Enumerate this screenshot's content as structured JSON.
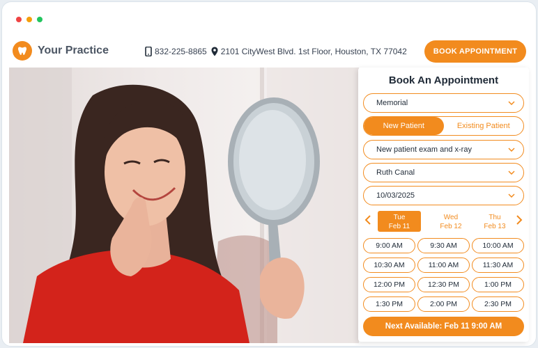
{
  "colors": {
    "accent": "#f28b1e",
    "dot_red": "#ef4444",
    "dot_yellow": "#f59e0b",
    "dot_green": "#22c55e"
  },
  "header": {
    "practice_name": "Your Practice",
    "phone": "832-225-8865",
    "address": "2101 CityWest Blvd. 1st Floor, Houston, TX 77042",
    "book_button": "BOOK APPOINTMENT"
  },
  "booking": {
    "title": "Book An Appointment",
    "location": "Memorial",
    "patient_tabs": [
      "New Patient",
      "Existing Patient"
    ],
    "selected_patient_tab": "New Patient",
    "reason": "New patient exam and x-ray",
    "provider": "Ruth Canal",
    "date": "10/03/2025",
    "days": [
      {
        "dow": "Tue",
        "date": "Feb 11"
      },
      {
        "dow": "Wed",
        "date": "Feb 12"
      },
      {
        "dow": "Thu",
        "date": "Feb 13"
      }
    ],
    "selected_day": "Feb 11",
    "times": [
      "9:00 AM",
      "9:30 AM",
      "10:00 AM",
      "10:30 AM",
      "11:00 AM",
      "11:30 AM",
      "12:00 PM",
      "12:30 PM",
      "1:00 PM",
      "1:30 PM",
      "2:00 PM",
      "2:30 PM"
    ],
    "next_available": "Next Available: Feb 11 9:00 AM"
  }
}
